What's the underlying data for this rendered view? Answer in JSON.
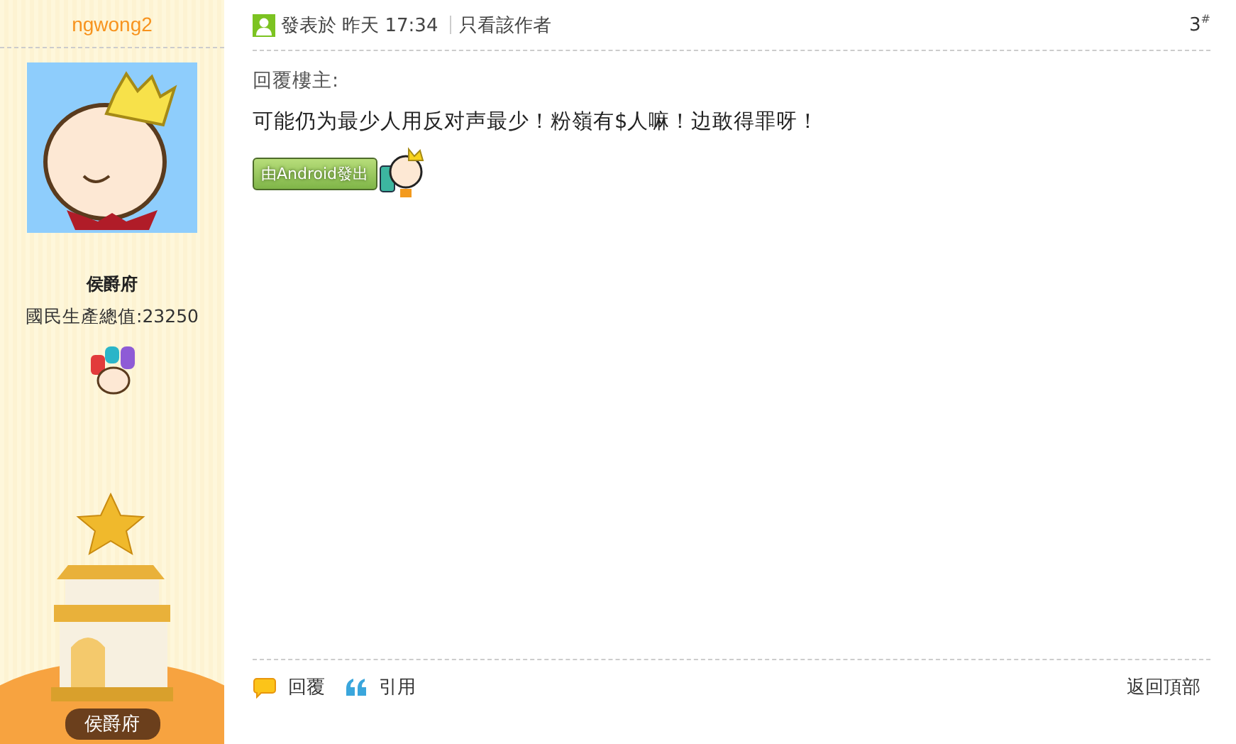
{
  "author": {
    "username": "ngwong2",
    "rank_title": "侯爵府",
    "stat": "國民生產總值:23250",
    "rank_badge": "侯爵府"
  },
  "post": {
    "posted": "發表於 昨天 17:34",
    "only_author": "只看該作者",
    "floor": "3$^{#}$",
    "reply_to": "回覆樓主:",
    "body": "可能仍为最少人用反对声最少！粉嶺有$人嘛！边敢得罪呀！",
    "client_badge": "由Android發出"
  },
  "actions": [
    {
      "kind": "reply",
      "label": "回覆"
    },
    {
      "kind": "quote",
      "label": "引用"
    }
  ],
  "back_to_top": "返回頂部"
}
